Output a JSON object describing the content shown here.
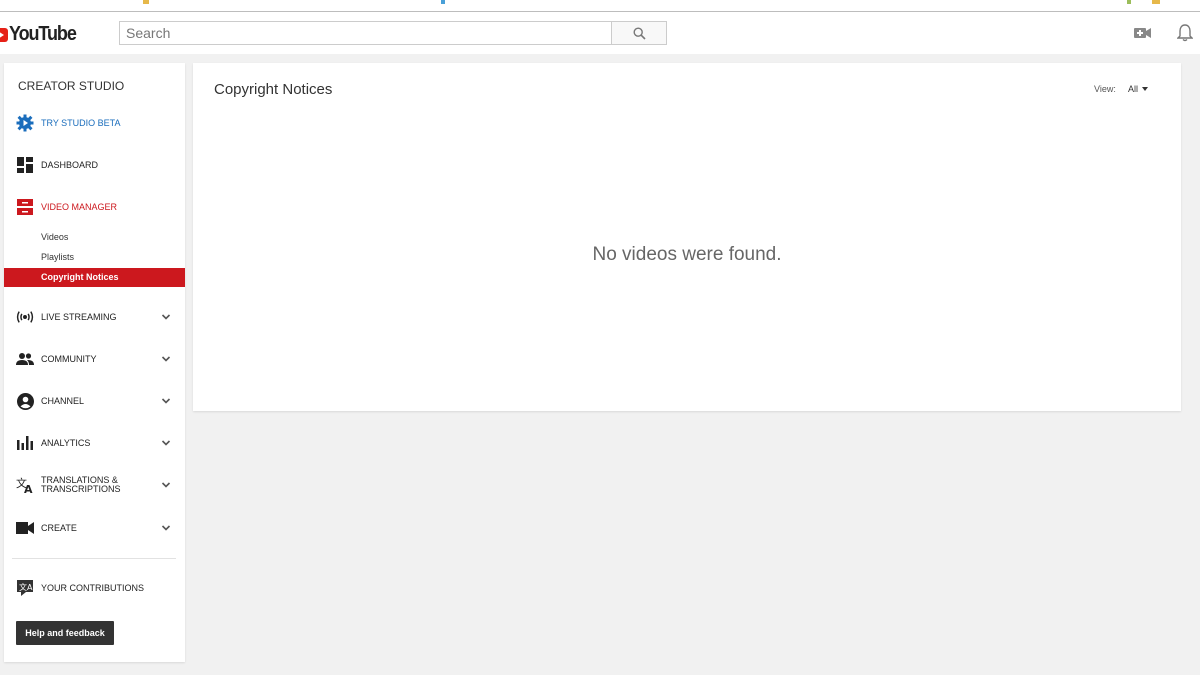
{
  "header": {
    "logo_text": "YouTube",
    "search_placeholder": "Search"
  },
  "sidebar": {
    "title": "CREATOR STUDIO",
    "items": [
      {
        "label": "TRY STUDIO BETA"
      },
      {
        "label": "DASHBOARD"
      },
      {
        "label": "VIDEO MANAGER"
      },
      {
        "label": "LIVE STREAMING"
      },
      {
        "label": "COMMUNITY"
      },
      {
        "label": "CHANNEL"
      },
      {
        "label": "ANALYTICS"
      },
      {
        "label": "TRANSLATIONS & TRANSCRIPTIONS"
      },
      {
        "label": "CREATE"
      },
      {
        "label": "YOUR CONTRIBUTIONS"
      }
    ],
    "sub_items": [
      {
        "label": "Videos"
      },
      {
        "label": "Playlists"
      },
      {
        "label": "Copyright Notices"
      }
    ],
    "help_label": "Help and feedback"
  },
  "main": {
    "title": "Copyright Notices",
    "view_label": "View:",
    "view_value": "All",
    "empty_message": "No videos were found."
  },
  "colors": {
    "accent_red": "#cc181e",
    "beta_blue": "#1a6dbc"
  }
}
